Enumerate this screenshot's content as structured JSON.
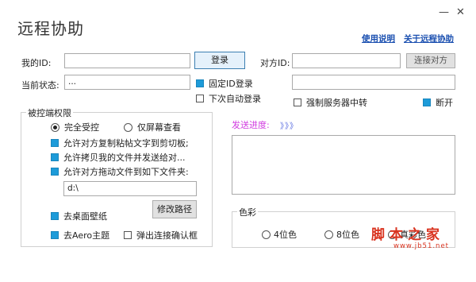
{
  "window": {
    "title": "远程协助",
    "minimize": "—",
    "close": "✕"
  },
  "links": {
    "usage": "使用说明",
    "about": "关于远程协助"
  },
  "my_id": {
    "label": "我的ID:",
    "value": ""
  },
  "login_button": "登录",
  "peer_id": {
    "label": "对方ID:",
    "value": ""
  },
  "connect_button": "连接对方",
  "status": {
    "label": "当前状态:",
    "value": "..."
  },
  "fixed_id_login": {
    "label": "固定ID登录",
    "checked": true
  },
  "auto_login": {
    "label": "下次自动登录",
    "checked": false
  },
  "peer_extra": {
    "value": ""
  },
  "force_relay": {
    "label": "强制服务器中转",
    "checked": false
  },
  "disconnect": {
    "label": "断开",
    "checked": true
  },
  "permissions": {
    "legend": "被控端权限",
    "full_control": "完全受控",
    "view_only": "仅屏幕查看",
    "options": [
      {
        "label": "允许对方复制粘帖文字到剪切板;",
        "checked": true
      },
      {
        "label": "允许拷贝我的文件并发送给对...",
        "checked": true
      },
      {
        "label": "允许对方拖动文件到如下文件夹:",
        "checked": true
      }
    ],
    "folder_path": "d:\\",
    "change_path_button": "修改路径",
    "remove_wallpaper": {
      "label": "去桌面壁纸",
      "checked": true
    },
    "remove_aero": {
      "label": "去Aero主题",
      "checked": true
    },
    "confirm_popup": {
      "label": "弹出连接确认框",
      "checked": false
    }
  },
  "send_progress": {
    "label": "发送进度:",
    "arrows": "》》》"
  },
  "color": {
    "legend": "色彩",
    "options": [
      {
        "label": "4位色",
        "selected": false
      },
      {
        "label": "8位色",
        "selected": false
      },
      {
        "label": "真彩色",
        "selected": false
      }
    ]
  },
  "watermark": {
    "line1": "脚本之家",
    "line2": "www.jb51.net"
  }
}
